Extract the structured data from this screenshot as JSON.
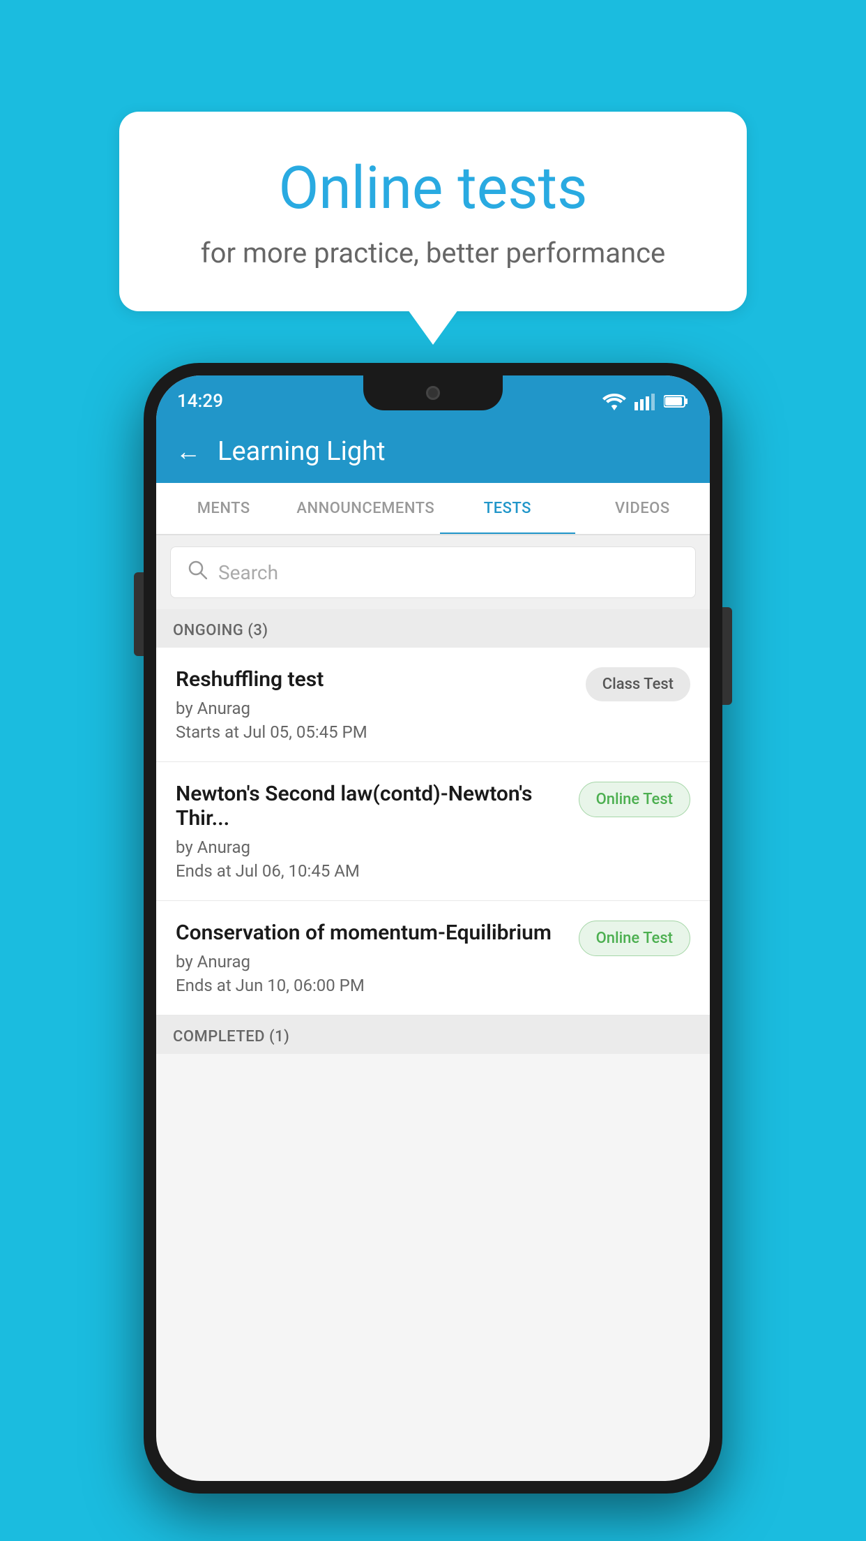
{
  "background": {
    "color": "#1BBCDF"
  },
  "bubble": {
    "title": "Online tests",
    "subtitle": "for more practice, better performance"
  },
  "phone": {
    "statusBar": {
      "time": "14:29",
      "wifiIcon": "wifi",
      "signalIcon": "signal",
      "batteryIcon": "battery"
    },
    "header": {
      "backLabel": "←",
      "title": "Learning Light"
    },
    "tabs": [
      {
        "label": "MENTS",
        "active": false
      },
      {
        "label": "ANNOUNCEMENTS",
        "active": false
      },
      {
        "label": "TESTS",
        "active": true
      },
      {
        "label": "VIDEOS",
        "active": false
      }
    ],
    "search": {
      "placeholder": "Search"
    },
    "sections": [
      {
        "name": "ONGOING",
        "count": 3,
        "label": "ONGOING (3)",
        "items": [
          {
            "name": "Reshuffling test",
            "by": "by Anurag",
            "date": "Starts at  Jul 05, 05:45 PM",
            "badgeLabel": "Class Test",
            "badgeType": "class"
          },
          {
            "name": "Newton's Second law(contd)-Newton's Thir...",
            "by": "by Anurag",
            "date": "Ends at  Jul 06, 10:45 AM",
            "badgeLabel": "Online Test",
            "badgeType": "online"
          },
          {
            "name": "Conservation of momentum-Equilibrium",
            "by": "by Anurag",
            "date": "Ends at  Jun 10, 06:00 PM",
            "badgeLabel": "Online Test",
            "badgeType": "online"
          }
        ]
      },
      {
        "name": "COMPLETED",
        "count": 1,
        "label": "COMPLETED (1)",
        "items": []
      }
    ]
  }
}
